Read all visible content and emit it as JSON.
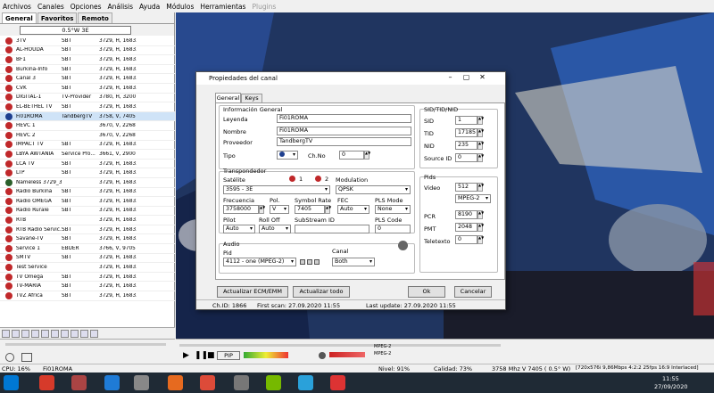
{
  "menu": [
    "Archivos",
    "Canales",
    "Opciones",
    "Análisis",
    "Ayuda",
    "Módulos",
    "Herramientas",
    "Plugins"
  ],
  "tabs": [
    "General",
    "Favoritos",
    "Remoto"
  ],
  "satellite": "0.5°W 3E",
  "channels": [
    {
      "name": "3TV",
      "prov": "SBT",
      "tp": "3729, H, 16833",
      "icon": "r"
    },
    {
      "name": "AL-HOUDA",
      "prov": "SBT",
      "tp": "3729, H, 16833",
      "icon": "r"
    },
    {
      "name": "BF1",
      "prov": "SBT",
      "tp": "3729, H, 16833",
      "icon": "r"
    },
    {
      "name": "Burkina-Info",
      "prov": "SBT",
      "tp": "3729, H, 16833",
      "icon": "r"
    },
    {
      "name": "Canal 3",
      "prov": "SBT",
      "tp": "3729, H, 16833",
      "icon": "r"
    },
    {
      "name": "CVK",
      "prov": "SBT",
      "tp": "3729, H, 16833",
      "icon": "r"
    },
    {
      "name": "DIGITAL-1",
      "prov": "TV-Provider",
      "tp": "3780, H, 3200",
      "icon": "r"
    },
    {
      "name": "EL-BETHEL TV",
      "prov": "SBT",
      "tp": "3729, H, 16833",
      "icon": "r"
    },
    {
      "name": "Fi01ROMA",
      "prov": "TandbergTV",
      "tp": "3758, V, 7405",
      "icon": "b",
      "sel": true
    },
    {
      "name": "HEVC 1",
      "prov": "",
      "tp": "3670, V, 2268 8...",
      "icon": "r"
    },
    {
      "name": "HEVC 2",
      "prov": "",
      "tp": "3670, V, 2268 8...",
      "icon": "r"
    },
    {
      "name": "IMPACT TV",
      "prov": "SBT",
      "tp": "3729, H, 16833",
      "icon": "r"
    },
    {
      "name": "LBYA AWTANIA",
      "prov": "Service Pro...",
      "tp": "3661, V, 2900",
      "icon": "r"
    },
    {
      "name": "LCA TV",
      "prov": "SBT",
      "tp": "3729, H, 16833",
      "icon": "r"
    },
    {
      "name": "LTP",
      "prov": "SBT",
      "tp": "3729, H, 16833",
      "icon": "r"
    },
    {
      "name": "Nameless 3729_3...",
      "prov": "",
      "tp": "3729, H, 16833",
      "icon": "g"
    },
    {
      "name": "Radio Burkina",
      "prov": "SBT",
      "tp": "3729, H, 16833",
      "icon": "r"
    },
    {
      "name": "Radio OMEGA",
      "prov": "SBT",
      "tp": "3729, H, 16833",
      "icon": "r"
    },
    {
      "name": "Radio Rurale",
      "prov": "SBT",
      "tp": "3729, H, 16833",
      "icon": "r"
    },
    {
      "name": "RTB",
      "prov": "",
      "tp": "3729, H, 16833",
      "icon": "r"
    },
    {
      "name": "RTB Radio Servic...",
      "prov": "SBT",
      "tp": "3729, H, 16833",
      "icon": "r"
    },
    {
      "name": "Savane-TV",
      "prov": "SBT",
      "tp": "3729, H, 16833",
      "icon": "r"
    },
    {
      "name": "Service 1",
      "prov": "EBUER",
      "tp": "3766, V, 9705",
      "icon": "r"
    },
    {
      "name": "SMTV",
      "prov": "SBT",
      "tp": "3729, H, 16833",
      "icon": "r"
    },
    {
      "name": "Test Service",
      "prov": "",
      "tp": "3729, H, 16833",
      "icon": "r"
    },
    {
      "name": "TV Omega",
      "prov": "SBT",
      "tp": "3729, H, 16833",
      "icon": "r"
    },
    {
      "name": "TV-MARIA",
      "prov": "SBT",
      "tp": "3729, H, 16833",
      "icon": "r"
    },
    {
      "name": "TVZ Africa",
      "prov": "SBT",
      "tp": "3729, H, 16833",
      "icon": "r"
    }
  ],
  "dialog": {
    "title": "Propiedades del canal",
    "tabs": [
      "General",
      "Keys"
    ],
    "info_group": "Información General",
    "leyenda_label": "Leyenda",
    "leyenda": "Fi01ROMA",
    "nombre_label": "Nombre",
    "nombre": "Fi01ROMA",
    "proveedor_label": "Proveedor",
    "proveedor": "TandbergTV",
    "tipo_label": "Tipo",
    "chno_label": "Ch.No",
    "chno": "0",
    "transp_group": "Transpondedor",
    "satelite_label": "Satélite",
    "sat1": "1",
    "sat2": "2",
    "satelite": "3595 - 3E",
    "modulation_label": "Modulation",
    "modulation": "QPSK",
    "frecuencia_label": "Frecuencia",
    "frecuencia": "3758000",
    "pol_label": "Pol.",
    "pol": "V",
    "sr_label": "Symbol Rate",
    "sr": "7405",
    "fec_label": "FEC",
    "fec": "Auto",
    "plsmode_label": "PLS Mode",
    "plsmode": "None",
    "pilot_label": "Pilot",
    "pilot": "Auto",
    "rolloff_label": "Roll Off",
    "rolloff": "Auto",
    "substream_label": "SubStream ID",
    "plscode_label": "PLS Code",
    "plscode": "0",
    "audio_group": "Audio",
    "pid_label": "Pid",
    "audio_pid": "4112 - one (MPEG-2)",
    "canal_label": "Canal",
    "canal": "Both",
    "sid_group": "SID/TID/NID",
    "sid_label": "SID",
    "sid": "1",
    "tid_label": "TID",
    "tid": "17185",
    "nid_label": "NID",
    "nid": "235",
    "srcid_label": "Source ID",
    "srcid": "0",
    "pids_group": "Pids",
    "video_label": "Video",
    "video": "512",
    "video_codec": "MPEG-2",
    "pcr_label": "PCR",
    "pcr": "8190",
    "pmt_label": "PMT",
    "pmt": "2048",
    "teletexto_label": "Teletexto",
    "teletexto": "0",
    "btn_update_ecm": "Actualizar ECM/EMM",
    "btn_update_all": "Actualizar todo",
    "btn_ok": "Ok",
    "btn_cancel": "Cancelar",
    "status_chid": "Ch.ID: 1866",
    "status_first": "First scan: 27.09.2020 11:55",
    "status_last": "Last update: 27.09.2020 11:55"
  },
  "controls": {
    "pip": "PIP",
    "mpeg1": "MPEG-2",
    "mpeg2": "MPEG-2"
  },
  "status": {
    "cpu": "CPU: 16%",
    "channel": "Fi01ROMA",
    "nivel": "Nivel: 91%",
    "calidad": "Calidad: 73%",
    "tp": "3758 Mhz  V  7405  ( 0.5° W)",
    "video": "[720x576i 9,86Mbps 4:2:2 25fps 16:9 Interlaced]"
  },
  "taskbar": {
    "time": "11:55",
    "date": "27/09/2020"
  },
  "colors": {
    "selected_row": "#cfe3f7",
    "taskbar": "#1f2a35",
    "icon_red": "#c0282a",
    "icon_blue": "#1e3f8f"
  }
}
